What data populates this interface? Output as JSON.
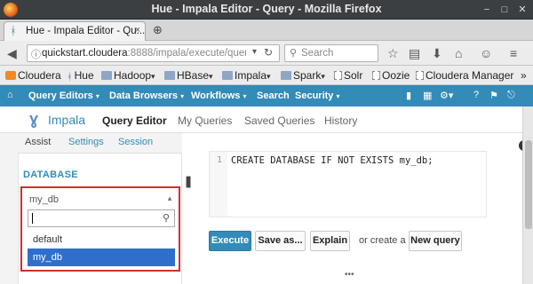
{
  "window": {
    "title": "Hue - Impala Editor - Query - Mozilla Firefox",
    "controls": {
      "minimize": "−",
      "maximize": "□",
      "close": "✕"
    }
  },
  "browser": {
    "tab": {
      "label": "Hue - Impala Editor - Qu...",
      "close": "×"
    },
    "newtab": "⊕",
    "url_host": "quickstart.cloudera",
    "url_path": ":8888/impala/execute/query/2:",
    "search_placeholder": "Search",
    "bookmarks": [
      {
        "label": "Cloudera",
        "icon": "cloudera-icon",
        "menu": false
      },
      {
        "label": "Hue",
        "icon": "hue-icon",
        "menu": false
      },
      {
        "label": "Hadoop",
        "icon": "folder-icon",
        "menu": true
      },
      {
        "label": "HBase",
        "icon": "folder-icon",
        "menu": true
      },
      {
        "label": "Impala",
        "icon": "folder-icon",
        "menu": true
      },
      {
        "label": "Spark",
        "icon": "folder-icon",
        "menu": true
      },
      {
        "label": "Solr",
        "icon": "page-icon",
        "menu": false
      },
      {
        "label": "Oozie",
        "icon": "page-icon",
        "menu": false
      },
      {
        "label": "Cloudera Manager",
        "icon": "page-icon",
        "menu": false
      }
    ],
    "bookmarks_more": "»"
  },
  "hue_nav": {
    "items": [
      "Query Editors",
      "Data Browsers",
      "Workflows",
      "Search",
      "Security"
    ]
  },
  "app": {
    "name": "Impala",
    "tabs": [
      "Query Editor",
      "My Queries",
      "Saved Queries",
      "History"
    ]
  },
  "assist": {
    "tabs": [
      "Assist",
      "Settings",
      "Session"
    ],
    "section_title": "DATABASE",
    "selected_db": "my_db",
    "options": [
      "default",
      "my_db"
    ],
    "highlighted": "my_db"
  },
  "editor": {
    "line_number": "1",
    "code": "CREATE DATABASE IF NOT EXISTS my_db;"
  },
  "actions": {
    "execute": "Execute",
    "save_as": "Save as...",
    "explain": "Explain",
    "or_create": "or create a",
    "new_query": "New query"
  },
  "colors": {
    "hue_blue": "#338bb8",
    "selection_blue": "#2f6fcb",
    "highlight_red": "#d32f2f"
  }
}
